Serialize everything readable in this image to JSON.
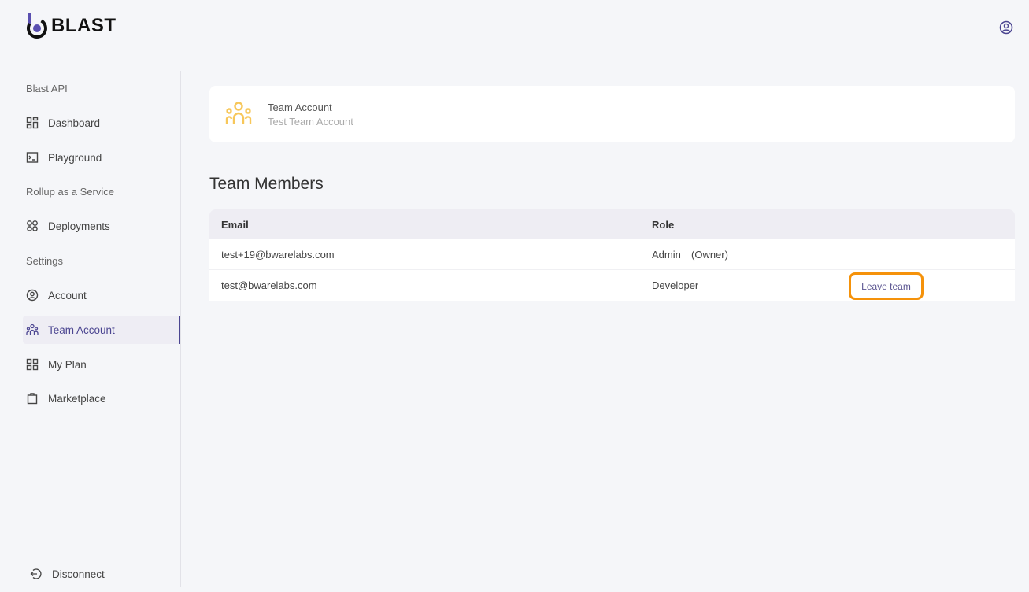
{
  "app": {
    "logo_text": "BLAST",
    "accent": "#4b4591"
  },
  "sidebar": {
    "sections": [
      {
        "label": "Blast API",
        "items": [
          {
            "label": "Dashboard",
            "icon": "dashboard-icon"
          },
          {
            "label": "Playground",
            "icon": "terminal-icon"
          }
        ]
      },
      {
        "label": "Rollup as a Service",
        "items": [
          {
            "label": "Deployments",
            "icon": "deployments-icon"
          }
        ]
      },
      {
        "label": "Settings",
        "items": [
          {
            "label": "Account",
            "icon": "user-circle-icon"
          },
          {
            "label": "Team Account",
            "icon": "team-icon",
            "active": true
          },
          {
            "label": "My Plan",
            "icon": "grid-icon"
          },
          {
            "label": "Marketplace",
            "icon": "bag-icon"
          }
        ]
      }
    ],
    "disconnect": "Disconnect"
  },
  "card": {
    "title": "Team Account",
    "subtitle": "Test Team Account",
    "icon_color": "#f7c75a"
  },
  "members": {
    "title": "Team Members",
    "columns": [
      "Email",
      "Role"
    ],
    "rows": [
      {
        "email": "test+19@bwarelabs.com",
        "role": "Admin",
        "role_note": "(Owner)"
      },
      {
        "email": "test@bwarelabs.com",
        "role": "Developer",
        "action": "Leave team"
      }
    ]
  }
}
